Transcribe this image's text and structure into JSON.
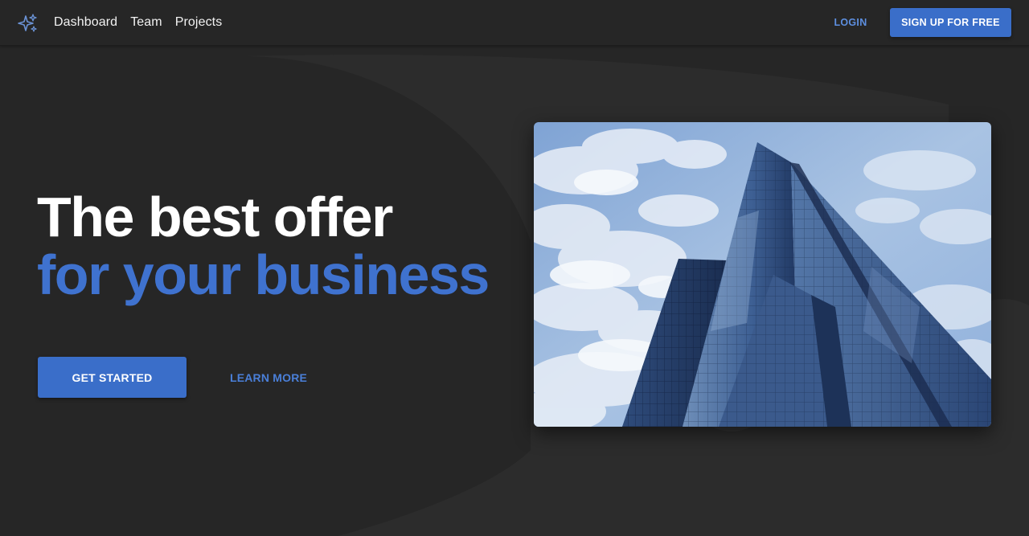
{
  "header": {
    "logo_icon": "sparkles-icon",
    "nav": [
      {
        "label": "Dashboard"
      },
      {
        "label": "Team"
      },
      {
        "label": "Projects"
      }
    ],
    "login_label": "LOGIN",
    "signup_label": "SIGN UP FOR FREE"
  },
  "hero": {
    "title_line1": "The best offer",
    "title_line2": "for your business",
    "primary_cta": "GET STARTED",
    "secondary_cta": "LEARN MORE",
    "image_icon": "skyscraper-photo"
  },
  "colors": {
    "background": "#262626",
    "accent": "#3a6ec9",
    "accent_text": "#4a7fd8",
    "text": "#ffffff"
  }
}
